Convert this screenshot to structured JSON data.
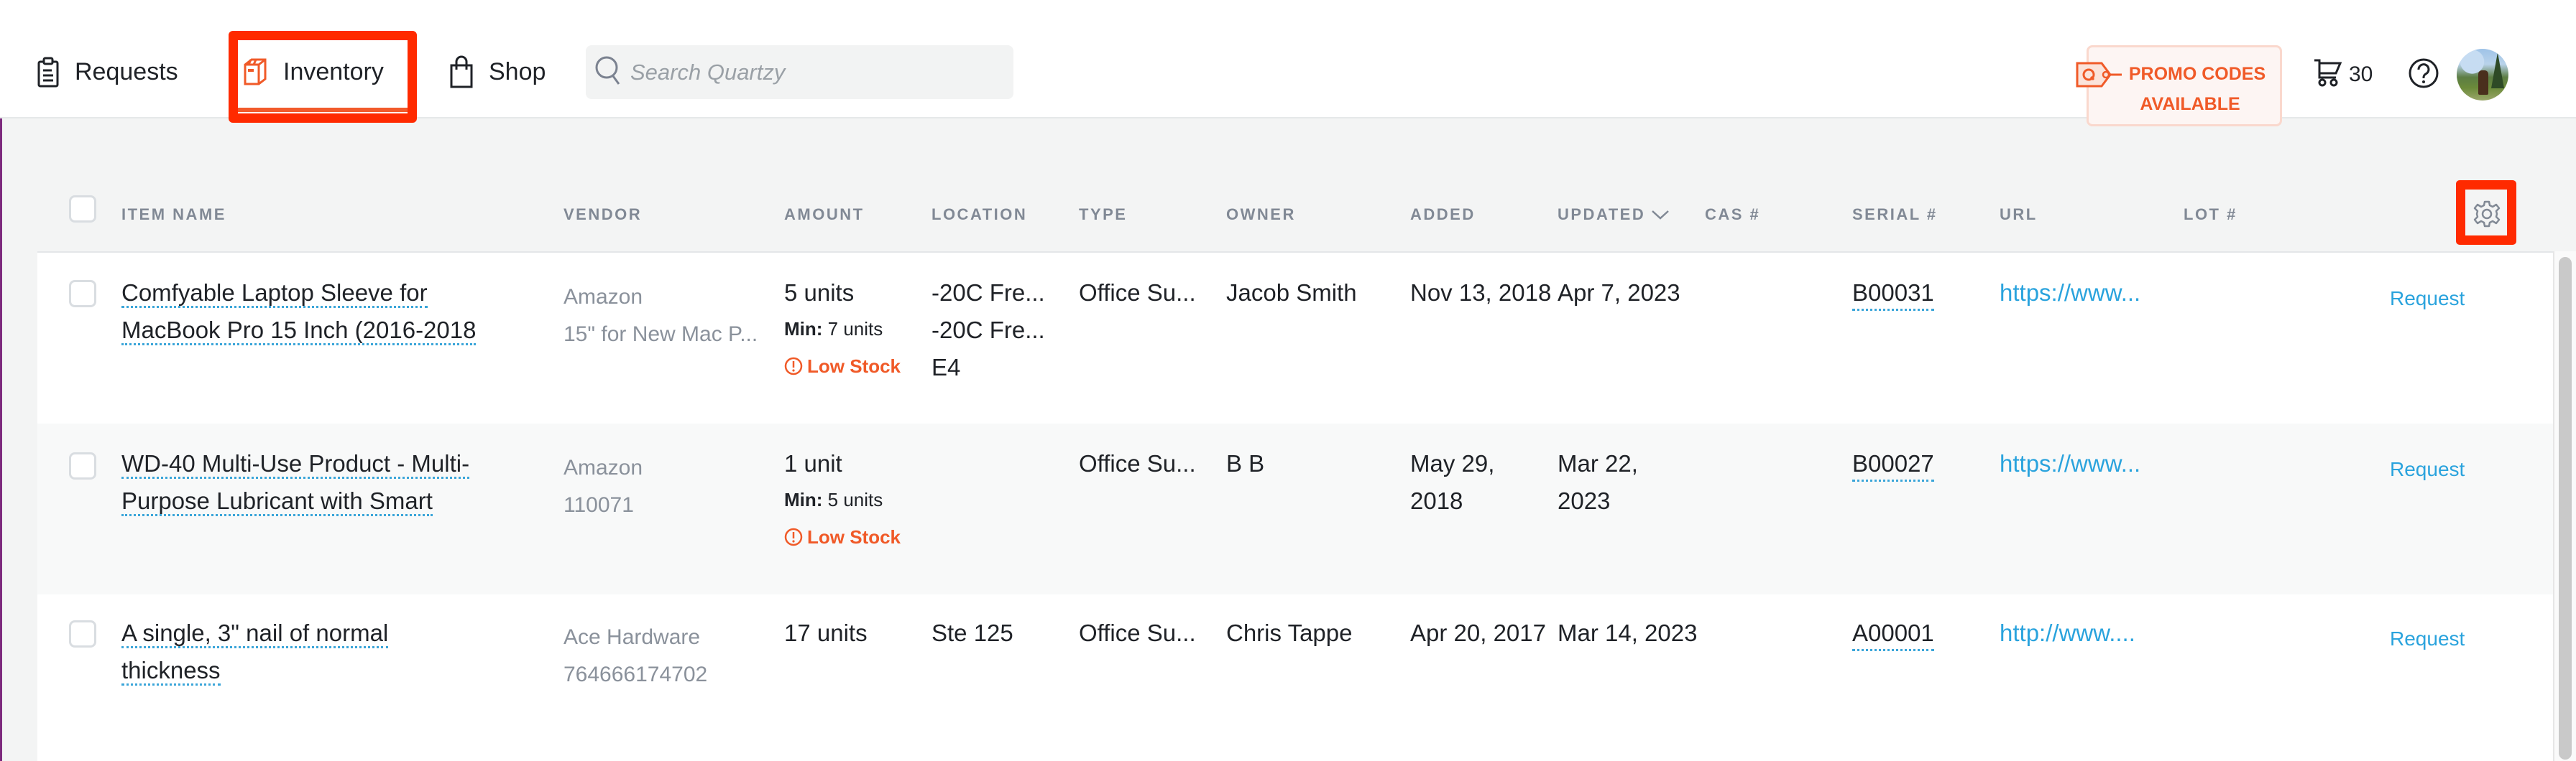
{
  "nav": {
    "items": [
      {
        "label": "Requests",
        "icon": "clipboard-icon"
      },
      {
        "label": "Inventory",
        "icon": "box-icon",
        "active": true
      },
      {
        "label": "Shop",
        "icon": "shopping-bag-icon"
      }
    ],
    "search": {
      "placeholder": "Search Quartzy",
      "value": ""
    },
    "promo": {
      "line1": "PROMO CODES",
      "line2": "AVAILABLE"
    },
    "cart_count": "30"
  },
  "colors": {
    "accent": "#f05a28",
    "link": "#2aa3dd",
    "highlight": "#ff2a00",
    "header_text": "#818995"
  },
  "table": {
    "columns": [
      "ITEM NAME",
      "VENDOR",
      "AMOUNT",
      "LOCATION",
      "TYPE",
      "OWNER",
      "ADDED",
      "UPDATED",
      "CAS #",
      "SERIAL #",
      "URL",
      "LOT #"
    ],
    "sort_column": "UPDATED",
    "sort_direction": "descending",
    "rows": [
      {
        "item_name": "Comfyable Laptop Sleeve for MacBook Pro 15 Inch (2016-2018",
        "vendor": "Amazon",
        "vendor_sub": "15\" for New Mac P...",
        "amount": "5 units",
        "min_label": "Min:",
        "min_value": "7 units",
        "low_stock": "Low Stock",
        "location_lines": [
          "-20C Fre...",
          "-20C Fre...",
          "E4"
        ],
        "type": "Office Su...",
        "owner": "Jacob Smith",
        "added": "Nov 13, 2018",
        "updated": "Apr 7, 2023",
        "cas": "",
        "serial": "B00031",
        "url": "https://www...",
        "lot": "",
        "action": "Request"
      },
      {
        "item_name": "WD-40 Multi-Use Product - Multi-Purpose Lubricant with Smart",
        "vendor": "Amazon",
        "vendor_sub": "110071",
        "amount": "1 unit",
        "min_label": "Min:",
        "min_value": "5 units",
        "low_stock": "Low Stock",
        "location_lines": [],
        "type": "Office Su...",
        "owner": "B B",
        "added": "May 29, 2018",
        "updated": "Mar 22, 2023",
        "cas": "",
        "serial": "B00027",
        "url": "https://www...",
        "lot": "",
        "action": "Request"
      },
      {
        "item_name": "A single, 3\" nail of normal thickness",
        "vendor": "Ace Hardware",
        "vendor_sub": "764666174702",
        "amount": "17 units",
        "min_label": "",
        "min_value": "",
        "low_stock": "",
        "location_lines": [
          "Ste 125"
        ],
        "type": "Office Su...",
        "owner": "Chris Tappe",
        "added": "Apr 20, 2017",
        "updated": "Mar 14, 2023",
        "cas": "",
        "serial": "A00001",
        "url": "http://www....",
        "lot": "",
        "action": "Request"
      }
    ]
  }
}
